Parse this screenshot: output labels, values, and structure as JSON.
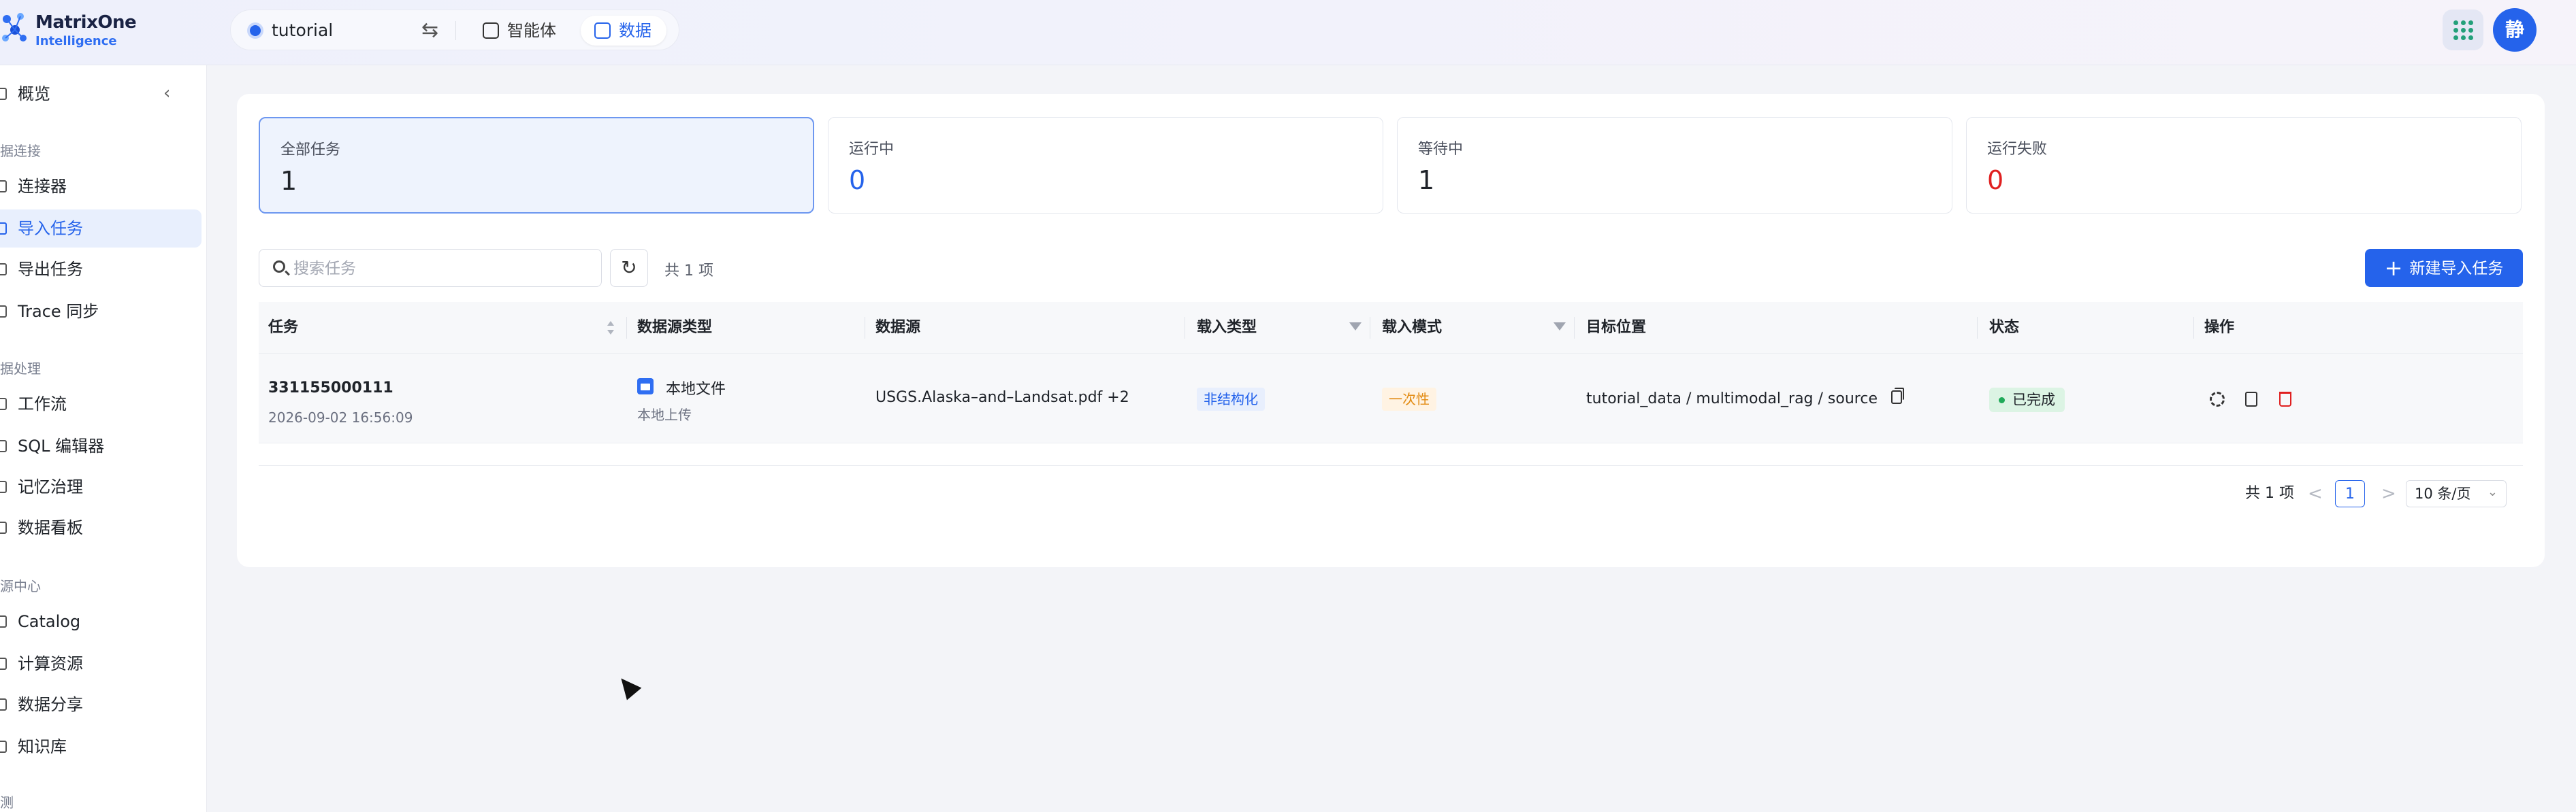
{
  "header": {
    "logo_line1": "MatrixOne",
    "logo_line2": "Intelligence",
    "workspace": "tutorial",
    "tabs": [
      {
        "label": "智能体"
      },
      {
        "label": "数据"
      }
    ],
    "avatar_text": "静",
    "accent_color": "#2563eb"
  },
  "sidebar": {
    "items": [
      {
        "label": "概览"
      },
      {
        "label": "连接器"
      },
      {
        "label": "导入任务"
      },
      {
        "label": "导出任务"
      },
      {
        "label": "Trace 同步"
      },
      {
        "label": "工作流"
      },
      {
        "label": "SQL 编辑器"
      },
      {
        "label": "记忆治理"
      },
      {
        "label": "数据看板"
      },
      {
        "label": "Catalog"
      },
      {
        "label": "计算资源"
      },
      {
        "label": "数据分享"
      },
      {
        "label": "知识库"
      }
    ],
    "groups": [
      "据连接",
      "据处理",
      "源中心",
      "测"
    ]
  },
  "stats": [
    {
      "label": "全部任务",
      "value": "1"
    },
    {
      "label": "运行中",
      "value": "0"
    },
    {
      "label": "等待中",
      "value": "1"
    },
    {
      "label": "运行失败",
      "value": "0"
    }
  ],
  "toolbar": {
    "search_placeholder": "搜索任务",
    "total_text": "共 1 项",
    "new_button_label": "新建导入任务"
  },
  "table": {
    "columns": [
      "任务",
      "数据源类型",
      "数据源",
      "载入类型",
      "载入模式",
      "目标位置",
      "状态",
      "操作"
    ],
    "rows": [
      {
        "task_id": "331155000111",
        "time": "2026-09-02 16:56:09",
        "source_type": "本地文件",
        "source_sub": "本地上传",
        "source": "USGS.Alaska–and–Landsat.pdf +2",
        "load_type": "非结构化",
        "load_mode": "一次性",
        "target": "tutorial_data / multimodal_rag / source",
        "status": "已完成"
      }
    ]
  },
  "pagination": {
    "total": "共 1 项",
    "prev": "<",
    "current": "1",
    "next": ">",
    "page_size": "10 条/页"
  }
}
